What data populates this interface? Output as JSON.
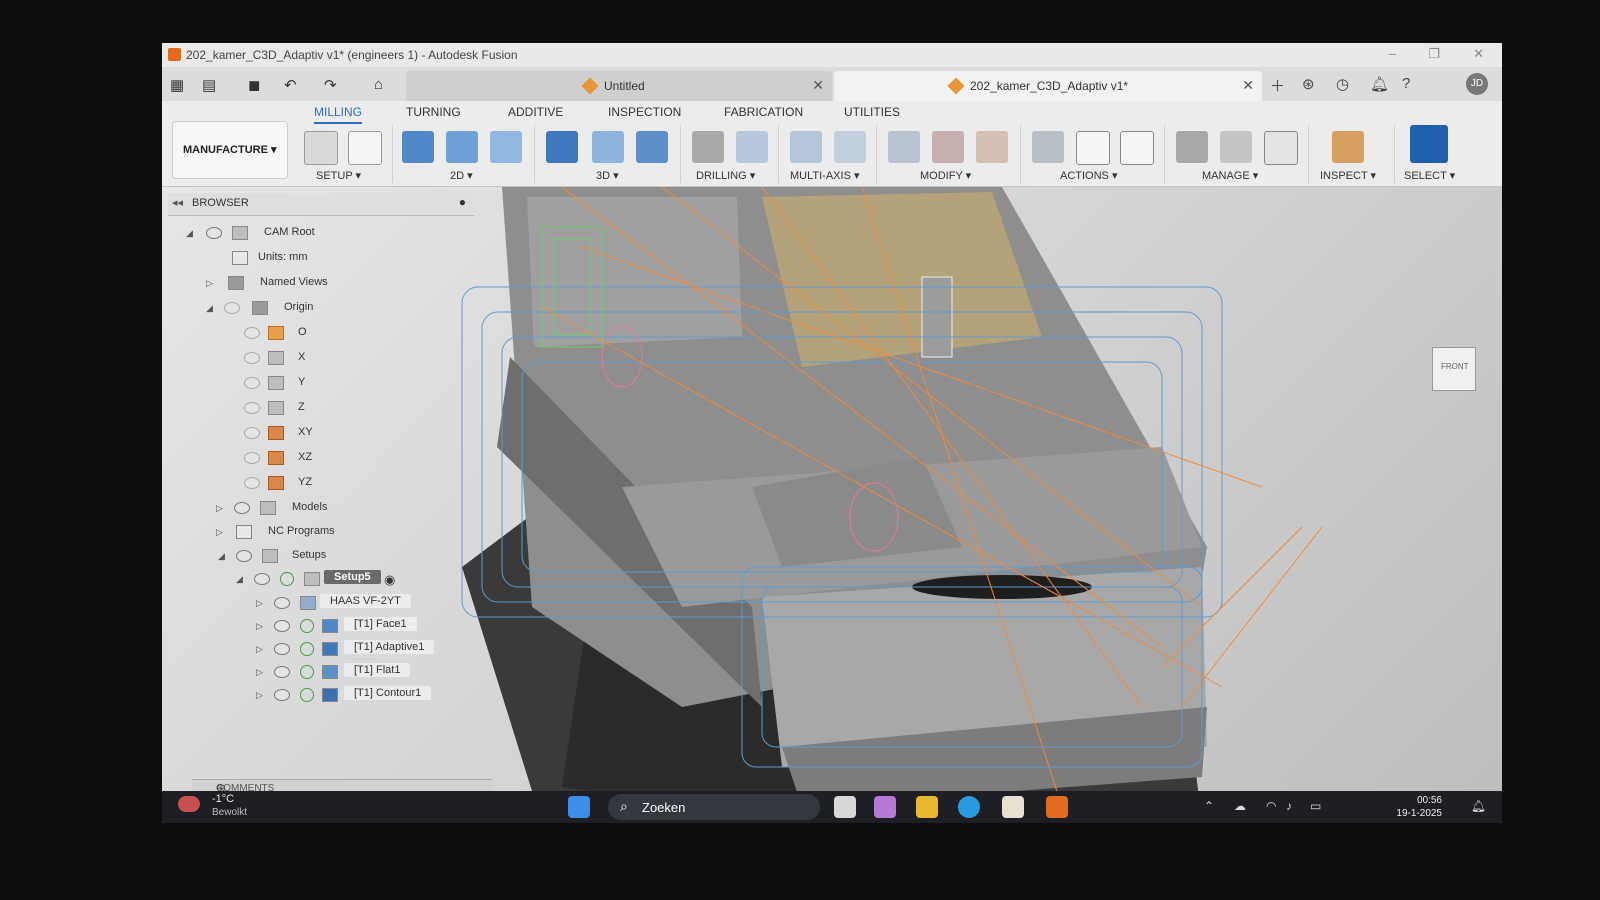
{
  "window": {
    "title": "202_kamer_C3D_Adaptiv v1* (engineers 1) - Autodesk Fusion",
    "controls": [
      "–",
      "❐",
      "✕"
    ]
  },
  "tabs": [
    {
      "label": "Untitled",
      "active": false
    },
    {
      "label": "202_kamer_C3D_Adaptiv v1*",
      "active": true
    }
  ],
  "user_initials": "JD",
  "ribbon": {
    "tabs": [
      "MILLING",
      "TURNING",
      "ADDITIVE",
      "INSPECTION",
      "FABRICATION",
      "UTILITIES"
    ],
    "active_tab": "MILLING",
    "workspace": "MANUFACTURE ▾",
    "groups": [
      "SETUP ▾",
      "2D ▾",
      "3D ▾",
      "DRILLING ▾",
      "MULTI-AXIS ▾",
      "MODIFY ▾",
      "ACTIONS ▾",
      "MANAGE ▾",
      "INSPECT ▾",
      "SELECT ▾"
    ]
  },
  "browser": {
    "title": "BROWSER",
    "rows": [
      {
        "label": "CAM Root"
      },
      {
        "label": "Units: mm"
      },
      {
        "label": "Named Views"
      },
      {
        "label": "Origin"
      },
      {
        "label": "O"
      },
      {
        "label": "X"
      },
      {
        "label": "Y"
      },
      {
        "label": "Z"
      },
      {
        "label": "XY"
      },
      {
        "label": "XZ"
      },
      {
        "label": "YZ"
      },
      {
        "label": "Models"
      },
      {
        "label": "NC Programs"
      },
      {
        "label": "Setups"
      },
      {
        "label": "Setup5"
      },
      {
        "label": "HAAS VF-2YT"
      },
      {
        "label": "[T1] Face1"
      },
      {
        "label": "[T1] Adaptive1"
      },
      {
        "label": "[T1] Flat1"
      },
      {
        "label": "[T1] Contour1"
      }
    ]
  },
  "viewcube": {
    "label": "FRONT"
  },
  "comments": {
    "label": "COMMENTS"
  },
  "taskbar": {
    "weather_temp": "-1°C",
    "weather_desc": "Bewolkt",
    "search_placeholder": "Zoeken",
    "time": "00:56",
    "date": "19-1-2025"
  },
  "colors": {
    "accent": "#2a6bc7",
    "toolpath_orange": "#f08a3c",
    "toolpath_blue": "#5b9bd6",
    "toolpath_green": "#6ad06a",
    "toolpath_pink": "#e8789a"
  }
}
